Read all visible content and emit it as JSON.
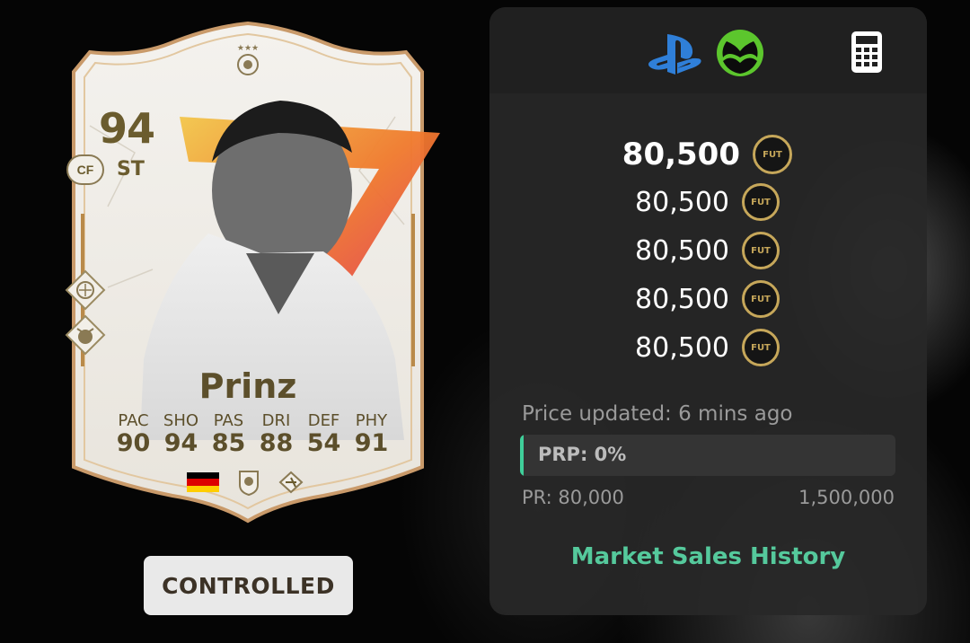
{
  "card": {
    "rating": "94",
    "position": "ST",
    "alt_position": "CF",
    "name": "Prinz",
    "stats": [
      {
        "label": "PAC",
        "value": "90"
      },
      {
        "label": "SHO",
        "value": "94"
      },
      {
        "label": "PAS",
        "value": "85"
      },
      {
        "label": "DRI",
        "value": "88"
      },
      {
        "label": "DEF",
        "value": "54"
      },
      {
        "label": "PHY",
        "value": "91"
      }
    ],
    "flag_colors": [
      "#000000",
      "#dd0000",
      "#ffce00"
    ],
    "accent_color": "#e0703a",
    "icons": [
      "league-icon",
      "club-icon",
      "playstyle-icon"
    ]
  },
  "controlled_button": {
    "label": "CONTROLLED"
  },
  "panel": {
    "platform_icons": [
      "playstation-icon",
      "xbox-icon",
      "calculator-icon"
    ],
    "main_price": "80,500",
    "coin_label": "FUT",
    "other_prices": [
      "80,500",
      "80,500",
      "80,500",
      "80,500"
    ],
    "updated_text": "Price updated: 6 mins ago",
    "prp_label": "PRP: 0%",
    "prp_fraction": 0.0,
    "pr_min": "PR: 80,000",
    "pr_max": "1,500,000",
    "history_link": "Market Sales History",
    "link_color": "#55c99c"
  }
}
